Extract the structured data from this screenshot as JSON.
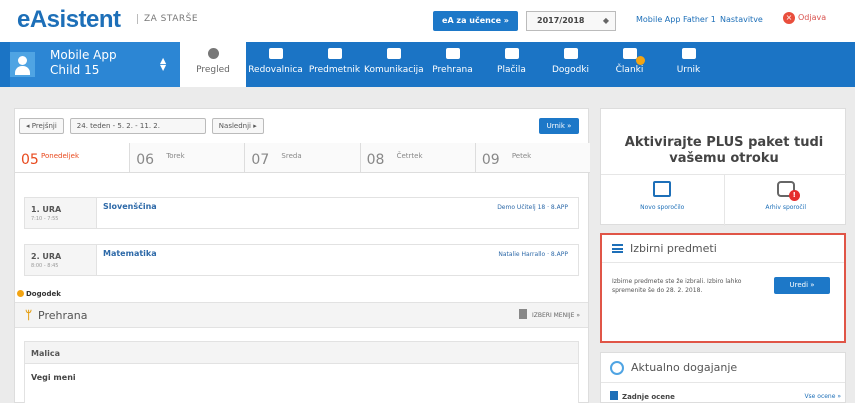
{
  "header": {
    "logo": "eAsistent",
    "logo_sub": "ZA STARŠE",
    "ucenca_button": "eA za učence »",
    "school_year": "2017/2018",
    "user": "Mobile App Father 1",
    "role": "Nastavitve",
    "logout": "Odjava"
  },
  "nav": {
    "child_name": "Mobile App Child 15",
    "tabs": [
      {
        "label": "Pregled",
        "icon": "dashboard-icon"
      },
      {
        "label": "Redovalnica",
        "icon": "gradebook-icon"
      },
      {
        "label": "Predmetnik",
        "icon": "book-icon"
      },
      {
        "label": "Komunikacija",
        "icon": "chat-icon"
      },
      {
        "label": "Prehrana",
        "icon": "food-icon"
      },
      {
        "label": "Plačila",
        "icon": "payment-icon"
      },
      {
        "label": "Dogodki",
        "icon": "calendar-icon"
      },
      {
        "label": "Članki",
        "icon": "articles-icon"
      },
      {
        "label": "Urnik",
        "icon": "timetable-icon"
      }
    ]
  },
  "week": {
    "prev": "◂ Prejšnji",
    "selected": "24. teden - 5. 2. - 11. 2.",
    "next": "Naslednji ▸",
    "urnik_button": "Urnik »"
  },
  "days": [
    {
      "num": "05",
      "name": "Ponedeljek"
    },
    {
      "num": "06",
      "name": "Torek"
    },
    {
      "num": "07",
      "name": "Sreda"
    },
    {
      "num": "08",
      "name": "Četrtek"
    },
    {
      "num": "09",
      "name": "Petek"
    }
  ],
  "lessons": [
    {
      "ura": "1. URA",
      "time": "7:10 - 7:55",
      "subject": "Slovenščina",
      "teacher": "Demo Učitelj 18 · 8.APP"
    },
    {
      "ura": "2. URA",
      "time": "8:00 - 8:45",
      "subject": "Matematika",
      "teacher": "Natalie Harrallo · 8.APP"
    }
  ],
  "events_label": "Dogodek",
  "prehrana": {
    "label": "Prehrana",
    "menu_button": "IZBERI MENIJE »",
    "meal": "Malica",
    "item": "Vegi meni"
  },
  "promo": {
    "title": "Aktivirajte PLUS paket tudi vašemu otroku",
    "new_message": "Novo sporočilo",
    "archive": "Arhiv sporočil"
  },
  "izbirni": {
    "title": "Izbirni predmeti",
    "text": "Izbirne predmete ste že izbrali. Izbiro lahko spremenite še do 28. 2. 2018.",
    "button": "Uredi »"
  },
  "aktualno": {
    "title": "Aktualno dogajanje",
    "row": "Zadnje ocene",
    "link": "Vse ocene »"
  }
}
